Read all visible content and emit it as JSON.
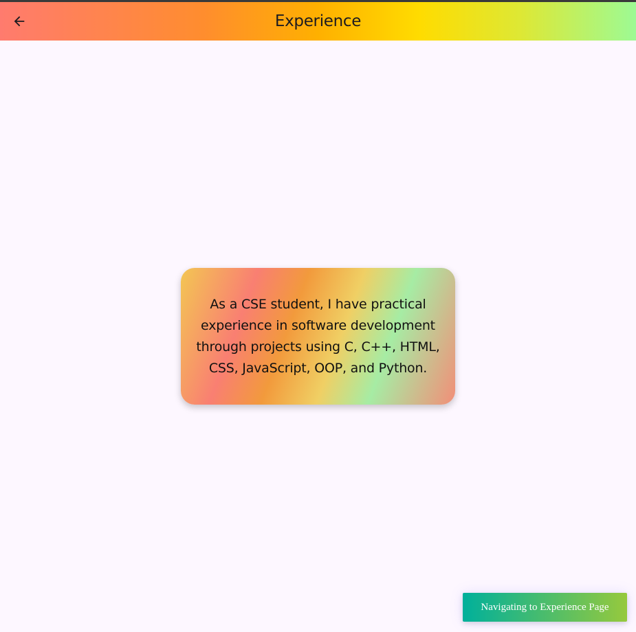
{
  "app_bar": {
    "back_icon": "arrow-left-icon",
    "title": "Experience"
  },
  "card": {
    "text": "As a CSE student, I have practical experience in software development through projects using C, C++, HTML, CSS, JavaScript, OOP, and Python."
  },
  "toast": {
    "text": "Navigating to Experience Page"
  },
  "colors": {
    "page_background": "#fdf7ff",
    "title_text": "#1d1b20",
    "toast_start": "#00b09b",
    "toast_end": "#96c93d"
  }
}
